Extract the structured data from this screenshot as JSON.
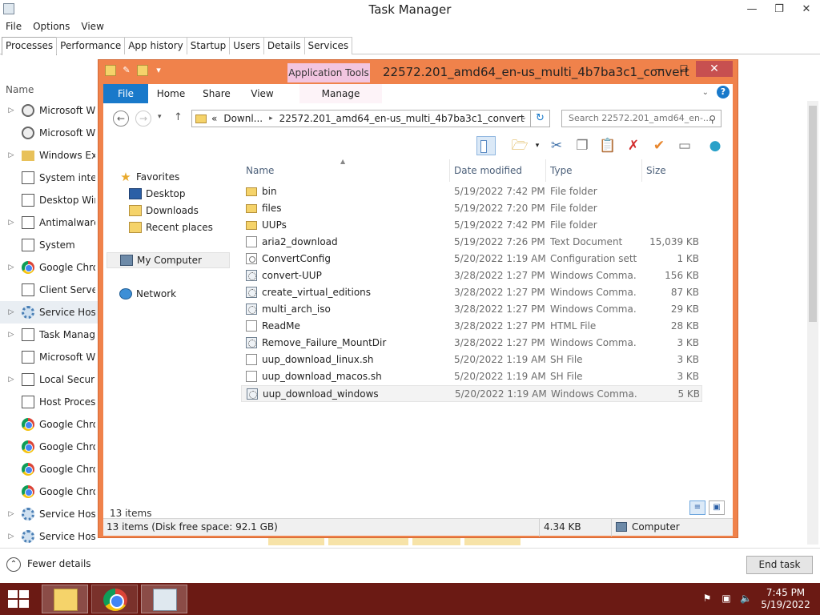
{
  "taskmanager": {
    "title": "Task Manager",
    "menu": [
      "File",
      "Options",
      "View"
    ],
    "tabs": [
      "Processes",
      "Performance",
      "App history",
      "Startup",
      "Users",
      "Details",
      "Services"
    ],
    "column_name": "Name",
    "processes": [
      {
        "name": "Microsoft Wir",
        "icon": "user-icon",
        "expand": true
      },
      {
        "name": "Microsoft Wir",
        "icon": "user-icon",
        "expand": false
      },
      {
        "name": "Windows Exp",
        "icon": "folder-icon",
        "expand": true
      },
      {
        "name": "System interr",
        "icon": "window-icon",
        "expand": false
      },
      {
        "name": "Desktop Wind",
        "icon": "window-icon",
        "expand": false
      },
      {
        "name": "Antimalware",
        "icon": "window-icon",
        "expand": true
      },
      {
        "name": "System",
        "icon": "window-icon",
        "expand": false
      },
      {
        "name": "Google Chron",
        "icon": "chrome-icon",
        "expand": true
      },
      {
        "name": "Client Server",
        "icon": "window-icon",
        "expand": false
      },
      {
        "name": "Service Host:",
        "icon": "gear-icon",
        "expand": true
      },
      {
        "name": "Task Manage",
        "icon": "taskmanager-icon",
        "expand": true
      },
      {
        "name": "Microsoft Wir",
        "icon": "window-icon",
        "expand": false
      },
      {
        "name": "Local Security",
        "icon": "window-icon",
        "expand": true
      },
      {
        "name": "Host Process",
        "icon": "window-icon",
        "expand": false
      },
      {
        "name": "Google Chron",
        "icon": "chrome-icon",
        "expand": false
      },
      {
        "name": "Google Chron",
        "icon": "chrome-icon",
        "expand": false
      },
      {
        "name": "Google Chron",
        "icon": "chrome-icon",
        "expand": false
      },
      {
        "name": "Google Chron",
        "icon": "chrome-icon",
        "expand": false
      },
      {
        "name": "Service Host:",
        "icon": "gear-icon",
        "expand": true
      },
      {
        "name": "Service Host:",
        "icon": "gear-icon",
        "expand": true
      }
    ],
    "fewer_details": "Fewer details",
    "end_task": "End task"
  },
  "explorer": {
    "title": "22572.201_amd64_en-us_multi_4b7ba3c1_convert",
    "context_tab": "Application Tools",
    "ribbon_tabs": {
      "file": "File",
      "home": "Home",
      "share": "Share",
      "view": "View",
      "manage": "Manage"
    },
    "address": {
      "crumb1": "Downl...",
      "crumb2": "22572.201_amd64_en-us_multi_4b7ba3c1_convert",
      "recent": "«"
    },
    "search_placeholder": "Search 22572.201_amd64_en-...",
    "sidebar": {
      "favorites": "Favorites",
      "desktop": "Desktop",
      "downloads": "Downloads",
      "recent_places": "Recent places",
      "my_computer": "My Computer",
      "network": "Network"
    },
    "columns": {
      "name": "Name",
      "date": "Date modified",
      "type": "Type",
      "size": "Size"
    },
    "files": [
      {
        "name": "bin",
        "date": "5/19/2022 7:42 PM",
        "type": "File folder",
        "size": "",
        "icon": "folder"
      },
      {
        "name": "files",
        "date": "5/19/2022 7:20 PM",
        "type": "File folder",
        "size": "",
        "icon": "folder"
      },
      {
        "name": "UUPs",
        "date": "5/19/2022 7:42 PM",
        "type": "File folder",
        "size": "",
        "icon": "folder"
      },
      {
        "name": "aria2_download",
        "date": "5/19/2022 7:26 PM",
        "type": "Text Document",
        "size": "15,039 KB",
        "icon": "doc"
      },
      {
        "name": "ConvertConfig",
        "date": "5/20/2022 1:19 AM",
        "type": "Configuration sett...",
        "size": "1 KB",
        "icon": "cfg"
      },
      {
        "name": "convert-UUP",
        "date": "3/28/2022 1:27 PM",
        "type": "Windows Comma...",
        "size": "156 KB",
        "icon": "cmd"
      },
      {
        "name": "create_virtual_editions",
        "date": "3/28/2022 1:27 PM",
        "type": "Windows Comma...",
        "size": "87 KB",
        "icon": "cmd"
      },
      {
        "name": "multi_arch_iso",
        "date": "3/28/2022 1:27 PM",
        "type": "Windows Comma...",
        "size": "29 KB",
        "icon": "cmd"
      },
      {
        "name": "ReadMe",
        "date": "3/28/2022 1:27 PM",
        "type": "HTML File",
        "size": "28 KB",
        "icon": "doc"
      },
      {
        "name": "Remove_Failure_MountDir",
        "date": "3/28/2022 1:27 PM",
        "type": "Windows Comma...",
        "size": "3 KB",
        "icon": "cmd"
      },
      {
        "name": "uup_download_linux.sh",
        "date": "5/20/2022 1:19 AM",
        "type": "SH File",
        "size": "3 KB",
        "icon": "doc"
      },
      {
        "name": "uup_download_macos.sh",
        "date": "5/20/2022 1:19 AM",
        "type": "SH File",
        "size": "3 KB",
        "icon": "doc"
      },
      {
        "name": "uup_download_windows",
        "date": "5/20/2022 1:19 AM",
        "type": "Windows Comma...",
        "size": "5 KB",
        "icon": "cmd"
      }
    ],
    "item_count": "13 items",
    "status": {
      "items": "13 items (Disk free space: 92.1 GB)",
      "size": "4.34 KB",
      "location": "Computer"
    }
  },
  "taskbar": {
    "clock_time": "7:45 PM",
    "clock_date": "5/19/2022"
  },
  "colors": {
    "explorer_frame": "#f0824b",
    "file_tab": "#1979ca",
    "context_tab": "#f2c5e0",
    "taskbar": "#6b1a14"
  }
}
